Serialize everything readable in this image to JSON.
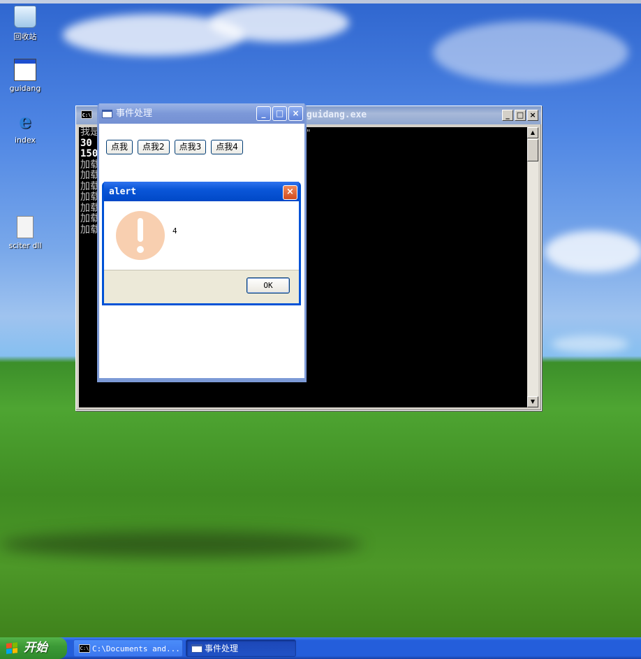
{
  "desktop": {
    "icons": [
      {
        "label": "回收站",
        "icon": "recycle-bin-icon"
      },
      {
        "label": "guidang",
        "icon": "program-window-icon"
      },
      {
        "label": "index",
        "icon": "internet-explorer-icon"
      },
      {
        "label": "sciter dll",
        "icon": "dll-file-icon"
      }
    ]
  },
  "console": {
    "title": "guidang.exe",
    "title_suffix_visible": "\"",
    "lines": [
      "我是",
      "30",
      "150",
      "加载",
      "加载",
      "加载",
      "加载",
      "加载",
      "加载",
      "加载"
    ],
    "min_label": "_",
    "max_label": "□",
    "close_label": "×"
  },
  "app_window": {
    "title": "事件处理",
    "buttons": [
      "点我",
      "点我2",
      "点我3",
      "点我4"
    ],
    "min_label": "_",
    "max_label": "□",
    "close_label": "×"
  },
  "alert": {
    "title": "alert",
    "message": "4",
    "ok_label": "OK",
    "icon": "warning-exclamation-icon",
    "icon_color": "#f8cfb0"
  },
  "taskbar": {
    "start_label": "开始",
    "tasks": [
      {
        "label": "C:\\Documents and...",
        "active": false
      },
      {
        "label": "事件处理",
        "active": true
      }
    ]
  },
  "colors": {
    "taskbar_blue": "#245edb",
    "start_green": "#3c9a37",
    "dialog_title_blue": "#0052d6",
    "inactive_title": "#7d9ad6"
  }
}
